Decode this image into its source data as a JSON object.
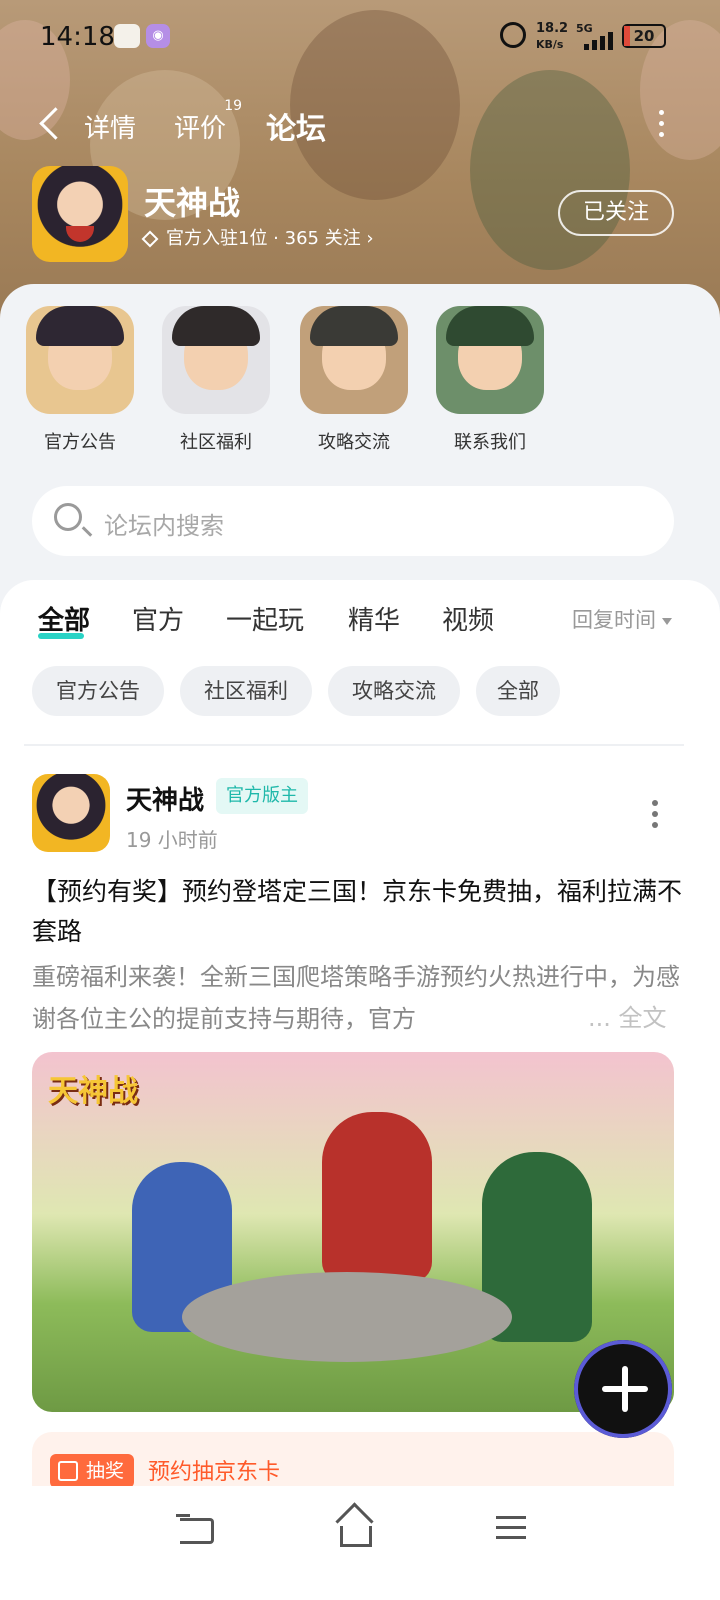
{
  "status_bar": {
    "time": "14:18",
    "net_speed": "18.2",
    "net_unit": "KB/s",
    "network": "5G",
    "battery": "20"
  },
  "nav": {
    "tabs": [
      {
        "label": "详情"
      },
      {
        "label": "评价",
        "badge": "19"
      },
      {
        "label": "论坛",
        "active": true
      }
    ]
  },
  "game": {
    "name": "天神战",
    "meta": "官方入驻1位 · 365 关注 ›",
    "follow_label": "已关注"
  },
  "shortcuts": [
    {
      "label": "官方公告",
      "icon": "official-notice-avatar"
    },
    {
      "label": "社区福利",
      "icon": "community-benefit-avatar"
    },
    {
      "label": "攻略交流",
      "icon": "guide-exchange-avatar"
    },
    {
      "label": "联系我们",
      "icon": "contact-us-avatar"
    }
  ],
  "search": {
    "placeholder": "论坛内搜索"
  },
  "feed": {
    "tabs": [
      "全部",
      "官方",
      "一起玩",
      "精华",
      "视频"
    ],
    "sort_label": "回复时间",
    "chips": [
      "官方公告",
      "社区福利",
      "攻略交流",
      "全部"
    ]
  },
  "post": {
    "author": "天神战",
    "badge": "官方版主",
    "time": "19 小时前",
    "title": "【预约有奖】预约登塔定三国！京东卡免费抽，福利拉满不套路",
    "excerpt": "重磅福利来袭！全新三国爬塔策略手游预约火热进行中，为感谢各位主公的提前支持与期待，官方",
    "read_more": "... 全文",
    "image_logo": "天神战",
    "lottery_badge": "抽奖",
    "lottery_text": "预约抽京东卡"
  },
  "colors": {
    "accent": "#29d3c5",
    "lottery": "#ff5a2a"
  }
}
